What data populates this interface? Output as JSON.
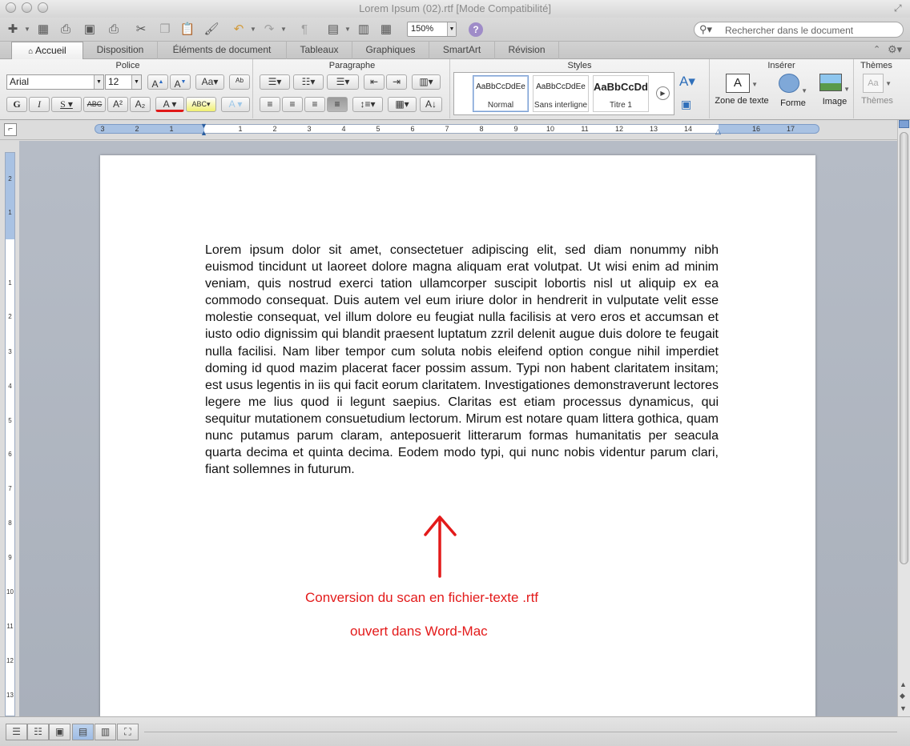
{
  "window": {
    "title": "Lorem Ipsum (02).rtf [Mode Compatibilité]"
  },
  "toolbar": {
    "zoom": "150%",
    "search_placeholder": "Rechercher dans le document"
  },
  "tabs": [
    {
      "label": "Accueil",
      "active": true
    },
    {
      "label": "Disposition"
    },
    {
      "label": "Éléments de document"
    },
    {
      "label": "Tableaux"
    },
    {
      "label": "Graphiques"
    },
    {
      "label": "SmartArt"
    },
    {
      "label": "Révision"
    }
  ],
  "ribbon": {
    "groups": {
      "police": "Police",
      "paragraphe": "Paragraphe",
      "styles": "Styles",
      "inserer": "Insérer",
      "themes": "Thèmes"
    },
    "font_name": "Arial",
    "font_size": "12",
    "styles": [
      {
        "sample": "AaBbCcDdEe",
        "label": "Normal"
      },
      {
        "sample": "AaBbCcDdEe",
        "label": "Sans interligne"
      },
      {
        "sample": "AaBbCcDd",
        "label": "Titre 1"
      }
    ],
    "insert_buttons": {
      "text_box": "Zone de texte",
      "shape": "Forme",
      "image": "Image",
      "themes": "Thèmes"
    }
  },
  "ruler": {
    "labels": [
      "3",
      "2",
      "1",
      "1",
      "2",
      "3",
      "4",
      "5",
      "6",
      "7",
      "8",
      "9",
      "10",
      "11",
      "12",
      "13",
      "14",
      "16",
      "17"
    ]
  },
  "vruler": {
    "labels": [
      "2",
      "1",
      "1",
      "2",
      "3",
      "4",
      "5",
      "6",
      "7",
      "8",
      "9",
      "10",
      "11",
      "12",
      "13"
    ]
  },
  "document": {
    "body": "Lorem ipsum dolor sit amet, consectetuer adipiscing elit, sed diam nonummy nibh euismod tincidunt ut laoreet dolore magna aliquam erat volutpat. Ut wisi enim ad minim veniam, quis nostrud exerci tation ullamcorper suscipit lobortis nisl ut aliquip ex ea commodo consequat. Duis autem vel eum iriure dolor in hendrerit in vulputate velit esse molestie consequat, vel illum dolore eu feugiat nulla facilisis at vero eros et accumsan et iusto odio dignissim qui blandit praesent luptatum zzril delenit augue duis dolore te feugait nulla facilisi. Nam liber tempor cum soluta nobis eleifend option congue nihil imperdiet doming id quod mazim placerat facer possim assum. Typi non habent claritatem insitam; est usus legentis in iis qui facit eorum claritatem. Investigationes demonstraverunt lectores legere me lius quod ii legunt saepius. Claritas est etiam processus dynamicus, qui sequitur mutationem consuetudium lectorum. Mirum est notare quam littera gothica, quam nunc putamus parum claram, anteposuerit litterarum formas humanitatis per seacula quarta decima et quinta decima. Eodem modo typi, qui nunc nobis videntur parum clari, fiant sollemnes in futurum.",
    "annotation_line1": "Conversion du scan en fichier-texte .rtf",
    "annotation_line2": "ouvert dans Word-Mac",
    "annotation_color": "#e31a1a"
  }
}
